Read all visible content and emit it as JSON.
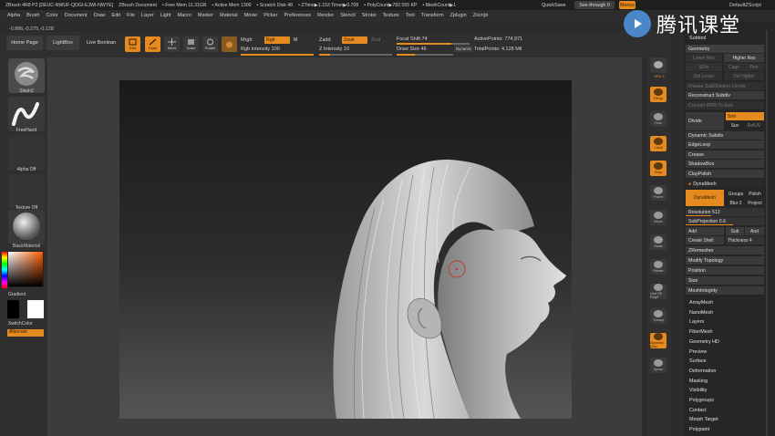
{
  "title_bar": {
    "app_title": "ZBrush 4R8 P2 [DEUC-NWUF-QDGI-EJWI-NWYE]",
    "document": "ZBrush Document",
    "free_mem": "• Free Mem 11.31GB",
    "active_mem": "• Active Mem 1300",
    "scratch_disk": "• Scratch Disk 48",
    "ztime": "• ZTime▶1.153 Timer▶0.708",
    "polycount": "• PolyCount▶782.555 KP",
    "meshcount": "• MeshCount▶1",
    "quicksave": "QuickSave",
    "see_through": "See-through 0",
    "menus": "Menus",
    "default_zscript": "DefaultZScript"
  },
  "menu_bar": {
    "items": [
      "Alpha",
      "Brush",
      "Color",
      "Document",
      "Draw",
      "Edit",
      "File",
      "Layer",
      "Light",
      "Macro",
      "Marker",
      "Material",
      "Movie",
      "Picker",
      "Preferences",
      "Render",
      "Stencil",
      "Stroke",
      "Texture",
      "Tool",
      "Transform",
      "Zplugin",
      "Zscript"
    ]
  },
  "coords": "-0.886,-0.275,-0.128",
  "top_shelf": {
    "home_page": "Home Page",
    "lightbox": "LightBox",
    "live_boolean": "Live Boolean",
    "tools": [
      {
        "label": "Edit",
        "active": true
      },
      {
        "label": "Draw",
        "active": true
      },
      {
        "label": "Move",
        "active": false
      },
      {
        "label": "Scale",
        "active": false
      },
      {
        "label": "Rotate",
        "active": false
      }
    ],
    "mrgb": "Mrgb",
    "rgb": "Rgb",
    "m": "M",
    "rgb_intensity_label": "Rgb Intensity",
    "rgb_intensity": "100",
    "zadd": "Zadd",
    "zsub": "Zsub",
    "zcut": "Zcut",
    "z_intensity_label": "Z Intensity",
    "z_intensity": "10",
    "focal_shift_label": "Focal Shift",
    "focal_shift": "74",
    "draw_size_label": "Draw Size",
    "draw_size": "46",
    "dynamic": "Dynamic",
    "active_points": "ActivePoints: 774,971",
    "total_points": "TotalPoints: 4.128 Mil"
  },
  "left_panel": {
    "brush": "Slash3",
    "stroke": "FreeHand",
    "alpha": "Alpha Off",
    "texture": "Texture Off",
    "material": "BasicMaterial",
    "gradient": "Gradient",
    "switch_color": "SwitchColor",
    "alternate": "Alternate"
  },
  "right_shelf": {
    "spix": "SPix 3",
    "items": [
      "Persp",
      "Floor",
      "Local",
      "Gxyz",
      "Frame",
      "Move",
      "Scale",
      "Rotate",
      "Line Fill PolyF",
      "Transp",
      "Dynamic Solo",
      "Xpose"
    ]
  },
  "right_panel": {
    "subtool": "Subtool",
    "geometry": "Geometry",
    "lower_res": "Lower Res",
    "higher_res": "Higher Res",
    "sdiv": "SDiv",
    "cage": "Cage",
    "rstr": "Rstr",
    "del_lower": "Del Lower",
    "del_higher": "Del Higher",
    "freeze_subdiv": "Freeze SubDivision Levels",
    "reconstruct_subdiv": "Reconstruct Subdiv",
    "convert_bpr": "Convert BPR To Geo",
    "divide": "Divide",
    "smt": "Smt",
    "suv": "Suv",
    "rel_uv": "RelUV",
    "dynamic_subdiv": "Dynamic Subdiv",
    "edgeloop": "EdgeLoop",
    "crease": "Crease",
    "shadowbox": "ShadowBox",
    "claypolish": "ClayPolish",
    "dynamesh_header": "DynaMesh",
    "dynamesh_btn": "DynaMesh",
    "groups": "Groups",
    "polish": "Polish",
    "blur": "Blur 2",
    "project": "Project",
    "resolution_label": "Resolution",
    "resolution": "512",
    "subprojection_label": "SubProjection",
    "subprojection": "0.6",
    "add": "Add",
    "sub": "Sub",
    "and": "And",
    "create_shell": "Create Shell",
    "thickness_label": "Thickness",
    "thickness": "4",
    "zremesher": "ZRemesher",
    "modify_topology": "Modify Topology",
    "position": "Position",
    "size": "Size",
    "meshintegrity": "MeshIntegrity",
    "sections": [
      "ArrayMesh",
      "NanoMesh",
      "Layers",
      "FiberMesh",
      "Geometry HD",
      "Preview",
      "Surface",
      "Deformation",
      "Masking",
      "Visibility",
      "Polygroups",
      "Contact",
      "Morph Target",
      "Polypaint"
    ]
  },
  "watermark": {
    "text": "腾讯课堂"
  },
  "colors": {
    "accent": "#e68a1f",
    "panel": "#2f2f2f",
    "watermark_blue": "#4a86c8"
  }
}
